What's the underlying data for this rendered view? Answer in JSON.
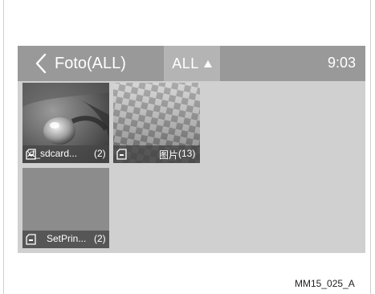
{
  "header": {
    "title": "Foto(ALL)",
    "filter_label": "ALL",
    "time": "9:03"
  },
  "albums": [
    {
      "name": "xt_sdcard...",
      "count": "(2)",
      "icon": "sd-card-icon",
      "thumbnail": "droplet-photo"
    },
    {
      "name": "图片",
      "count": "(13)",
      "icon": "sd-card-icon",
      "thumbnail": "checkered-texture"
    },
    {
      "name": "SetPrin...",
      "count": "(2)",
      "icon": "sd-card-icon",
      "thumbnail": "blank-gray"
    }
  ],
  "figure_code": "MM15_025_A",
  "colors": {
    "top_bar": "#999999",
    "filter_button": "#b4b4b4",
    "screen_background": "#d0d0d0",
    "caption_overlay": "#464646"
  }
}
